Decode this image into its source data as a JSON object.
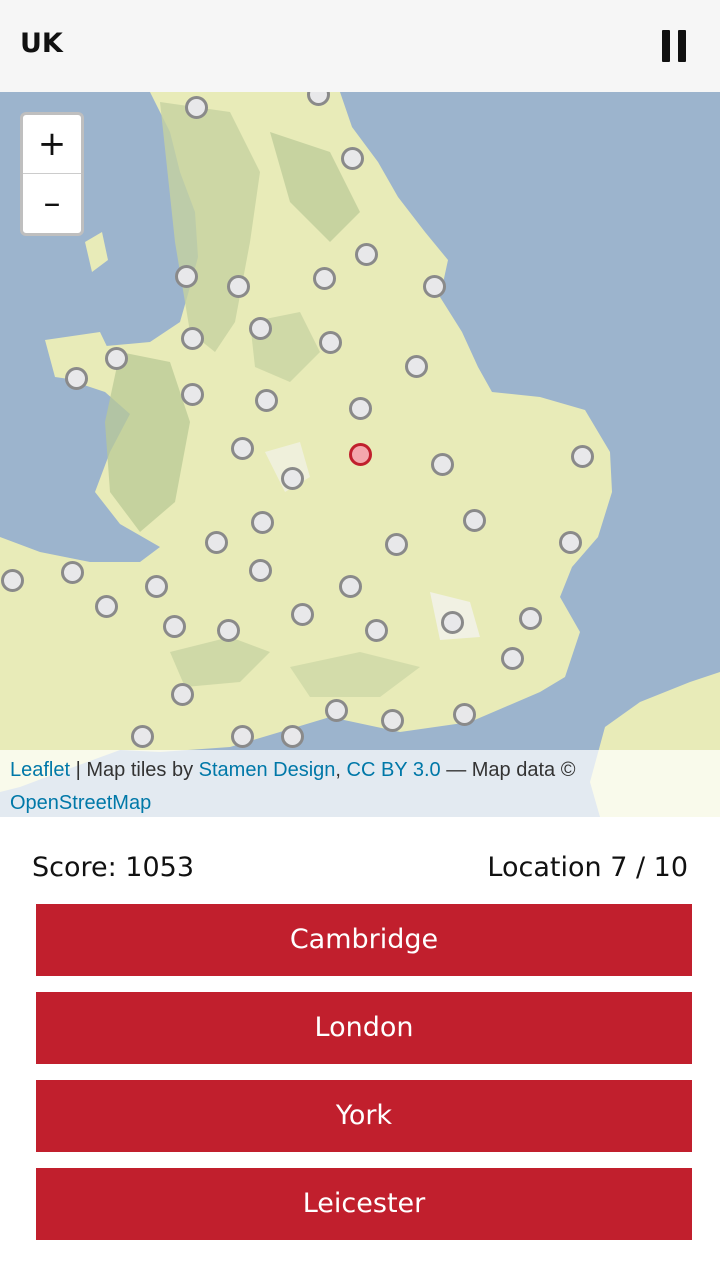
{
  "header": {
    "title": "UK",
    "pause_icon": "pause-icon"
  },
  "map": {
    "zoom_in_label": "+",
    "zoom_out_label": "–",
    "attribution": {
      "leaflet": "Leaflet",
      "sep1": " | Map tiles by ",
      "stamen": "Stamen Design",
      "comma": ", ",
      "cc": "CC BY 3.0",
      "mapdata": " — Map data © ",
      "osm": "OpenStreetMap"
    },
    "colors": {
      "sea": "#9cb4cd",
      "land": "#e8ebb8",
      "hills": "#b9c995",
      "marker_fill": "#e8e8ea",
      "marker_border": "#8a8a8a",
      "active_marker": "#c0202d"
    }
  },
  "status": {
    "score": "Score: 1053",
    "location": "Location 7 / 10"
  },
  "answers": [
    "Cambridge",
    "London",
    "York",
    "Leicester"
  ],
  "colors": {
    "button": "#c11f2d",
    "header_bg": "#f6f6f6"
  }
}
